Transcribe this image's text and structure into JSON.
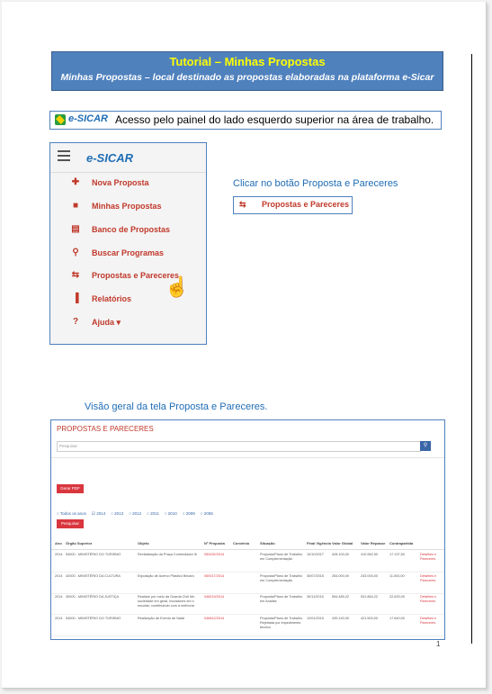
{
  "header": {
    "title": "Tutorial – Minhas Propostas",
    "subtitle": "Minhas Propostas – local destinado as propostas elaboradas na plataforma e-Sicar"
  },
  "access": {
    "logo": "e-SICAR",
    "text": "Acesso pelo painel do lado esquerdo superior na área de trabalho."
  },
  "menu": {
    "logo": "e-SICAR",
    "items": [
      {
        "icon": "plus-icon",
        "glyph": "✚",
        "label": "Nova Proposta"
      },
      {
        "icon": "folder-icon",
        "glyph": "■",
        "label": "Minhas Propostas"
      },
      {
        "icon": "files-icon",
        "glyph": "▤",
        "label": "Banco de Propostas"
      },
      {
        "icon": "search-icon",
        "glyph": "⚲",
        "label": "Buscar Programas"
      },
      {
        "icon": "retweet-icon",
        "glyph": "⇆",
        "label": "Propostas e Pareceres"
      },
      {
        "icon": "chart-icon",
        "glyph": "▐",
        "label": "Relatórios"
      },
      {
        "icon": "question-icon",
        "glyph": "?",
        "label": "Ajuda ▾"
      }
    ]
  },
  "instruction": {
    "text": "Clicar no botão Proposta e Pareceres",
    "button_label": "Propostas e Pareceres",
    "button_glyph": "⇆"
  },
  "overview": {
    "caption": "Visão geral da tela Proposta e Pareceres."
  },
  "screen": {
    "title": "PROPOSTAS E PARECERES",
    "search_placeholder": "Pesquisar",
    "search_glyph": "⚲",
    "pdf_button": "Gerar PDF",
    "year_filters": [
      "Todos os anos",
      "2014",
      "2013",
      "2012",
      "2011",
      "2010",
      "2009",
      "2008"
    ],
    "checked_year": "2014",
    "search_button": "Pesquisar",
    "columns": [
      "Ano",
      "Órgão Superior",
      "Objeto",
      "Nº Proposta",
      "Convênio",
      "Situação",
      "Final Vigência",
      "Valor Global",
      "Valor Repasse",
      "Contrapartida",
      ""
    ],
    "rows": [
      [
        "2014",
        "54000 - MINISTÉRIO DO TURISMO",
        "Revitalização da Praça Comendador Iti",
        "050432/2014",
        "",
        "Proposta/Plano de Trabalho em Complementação",
        "10/10/2017",
        "428.100,00",
        "410.962,50",
        "17.137,50",
        "Detalhes e Pareceres"
      ],
      [
        "2014",
        "42000 - MINISTÉRIO DA CULTURA",
        "Exposição de Acervo Plástico Becaro",
        "050017/2014",
        "",
        "Proposta/Plano de Trabalho em Complementação",
        "30/07/2015",
        "254.000,00",
        "243.000,00",
        "11.000,00",
        "Detalhes e Pareceres"
      ],
      [
        "2014",
        "30000 - MINISTÉRIO DA JUSTIÇA",
        "Realizar por meio da Guarda Civil Mu sociedade em geral, moradores em s escolas, contribuindo com a melhoria",
        "048219/2014",
        "",
        "Proposta/Plano de Trabalho em Análise",
        "30/11/2015",
        "554.489,22",
        "531.864,22",
        "22.625,00",
        "Detalhes e Pareceres"
      ],
      [
        "2014",
        "54000 - MINISTÉRIO DO TURISMO",
        "Realização de Evento de Natal",
        "046812/2014",
        "",
        "Proposta/Plano de Trabalho Rejeitada por impedimento técnico",
        "12/01/2015",
        "439.140,00",
        "421.500,00",
        "17.640,00",
        "Detalhes e Pareceres"
      ]
    ]
  },
  "page_number": "1"
}
